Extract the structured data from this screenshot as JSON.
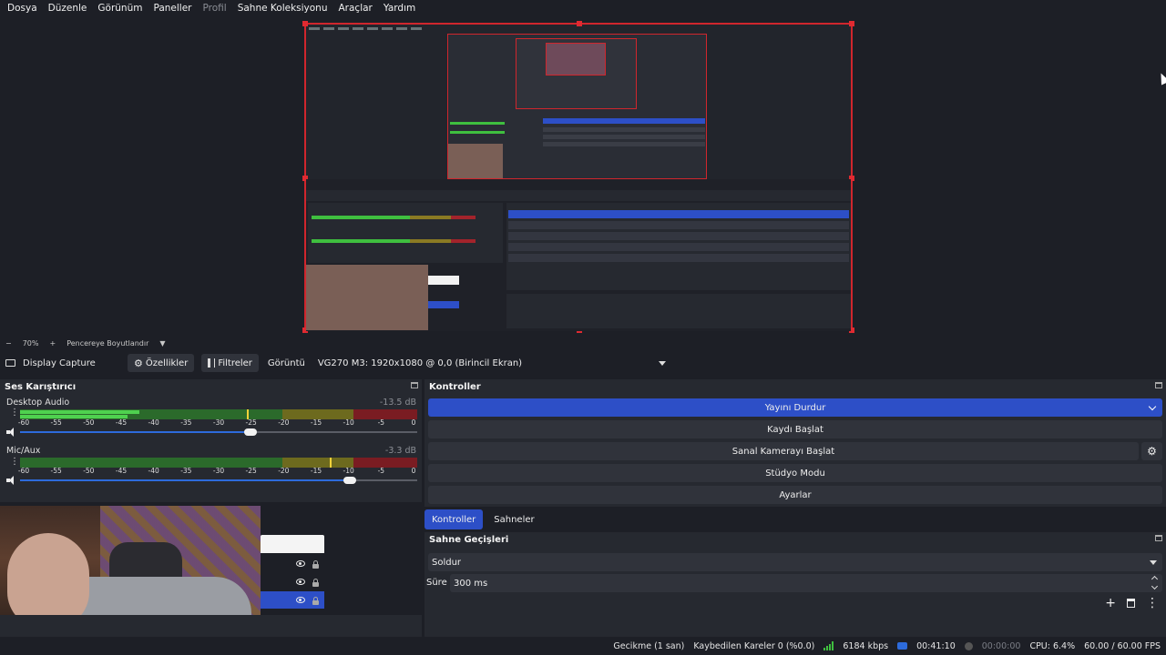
{
  "menu": [
    "Dosya",
    "Düzenle",
    "Görünüm",
    "Paneller",
    "Profil",
    "Sahne Koleksiyonu",
    "Araçlar",
    "Yardım"
  ],
  "menu_disabled_index": 4,
  "preview": {
    "zoom": "70%",
    "fit_label": "Pencereye Boyutlandır"
  },
  "source_toolbar": {
    "source_name": "Display Capture",
    "properties_label": "Özellikler",
    "filters_label": "Filtreler",
    "display_label": "Görüntü",
    "display_value": "VG270 M3: 1920x1080 @ 0,0 (Birincil Ekran)"
  },
  "mixer": {
    "title": "Ses Karıştırıcı",
    "channels": [
      {
        "name": "Desktop Audio",
        "db": "-13.5 dB",
        "level": 0.3,
        "peak": 0.57,
        "volume": 0.58
      },
      {
        "name": "Mic/Aux",
        "db": "-3.3 dB",
        "level": 0.0,
        "peak": 0.78,
        "volume": 0.83
      }
    ],
    "ticks": [
      "-60",
      "-55",
      "-50",
      "-45",
      "-40",
      "-35",
      "-30",
      "-25",
      "-20",
      "-15",
      "-10",
      "-5",
      "0"
    ]
  },
  "controls": {
    "title": "Kontroller",
    "stop_stream": "Yayını Durdur",
    "start_record": "Kaydı Başlat",
    "start_virtualcam": "Sanal Kamerayı Başlat",
    "studio_mode": "Stüdyo Modu",
    "settings": "Ayarlar"
  },
  "tabs": {
    "controls": "Kontroller",
    "scenes": "Sahneler"
  },
  "transitions": {
    "title": "Sahne Geçişleri",
    "selected": "Soldur",
    "duration_label": "Süre",
    "duration_value": "300 ms"
  },
  "status": {
    "delay": "Gecikme (1 san)",
    "dropped": "Kaybedilen Kareler 0 (%0.0)",
    "bitrate": "6184 kbps",
    "stream_time": "00:41:10",
    "record_time": "00:00:00",
    "cpu": "CPU: 6.4%",
    "fps": "60.00 / 60.00 FPS"
  },
  "colors": {
    "accent": "#2d4fc7",
    "selection_border": "#d0262d",
    "meter_green": "#4fd14f"
  }
}
